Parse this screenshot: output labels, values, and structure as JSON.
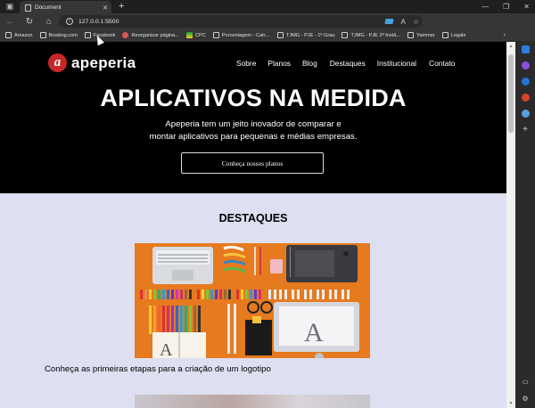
{
  "browser": {
    "tab_title": "Document",
    "url": "127.0.0.1:5500",
    "bookmarks": [
      {
        "label": "Amazon",
        "icon": "doc-icon"
      },
      {
        "label": "Booking.com",
        "icon": "doc-icon"
      },
      {
        "label": "Facebook",
        "icon": "doc-icon"
      },
      {
        "label": "Reorganizar página...",
        "icon": "red-circle-icon"
      },
      {
        "label": "CPC",
        "icon": "flag-icon"
      },
      {
        "label": "Porcentagem - Calc...",
        "icon": "doc-icon"
      },
      {
        "label": "TJMG - PJE - 1º Grau",
        "icon": "doc-icon"
      },
      {
        "label": "TJMG - PJE 2ª Instâ...",
        "icon": "doc-icon"
      },
      {
        "label": "Yammer",
        "icon": "doc-icon"
      },
      {
        "label": "Legale",
        "icon": "doc-icon"
      }
    ]
  },
  "site": {
    "logo_letter": "a",
    "logo_name": "apeperia",
    "nav": [
      "Sobre",
      "Planos",
      "Blog",
      "Destaques",
      "Institucional",
      "Contato"
    ],
    "hero_title": "APLICATIVOS NA MEDIDA",
    "hero_line1": "Apeperia tem um jeito inovador de comparar e",
    "hero_line2": "montar aplicativos para pequenas e médias empresas.",
    "cta_label": "Conheça nossos planos",
    "section_title": "DESTAQUES",
    "featured_caption": "Conheça as primeiras etapas para a criação de um logotipo"
  },
  "colors": {
    "hero_bg": "#000000",
    "page_bg": "#dedff0",
    "logo_red": "#c62828",
    "featured_orange": "#e67a1f"
  }
}
